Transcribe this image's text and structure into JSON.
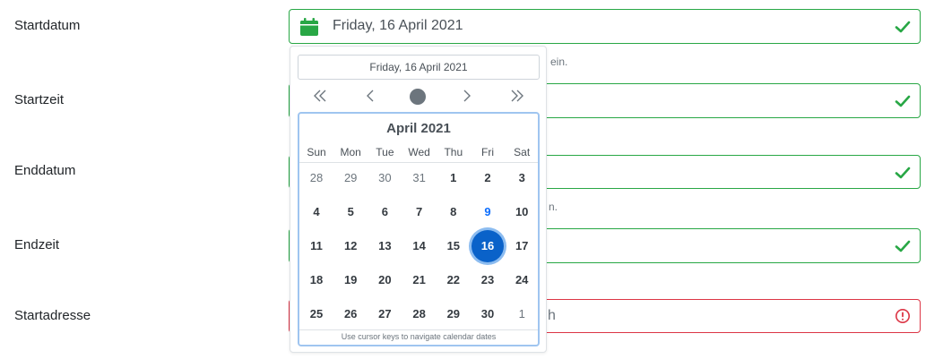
{
  "form": {
    "rows": [
      {
        "label": "Startdatum",
        "value": "Friday, 16 April 2021"
      },
      {
        "label": "Startzeit"
      },
      {
        "label": "Enddatum"
      },
      {
        "label": "Endzeit"
      },
      {
        "label": "Startadresse",
        "placeholder_tail": "h"
      }
    ],
    "help_fragments": {
      "row1": "ein.",
      "row3": "n."
    },
    "valid_color": "#28a745",
    "invalid_color": "#dc3545"
  },
  "datepicker": {
    "selected_text": "Friday, 16 April 2021",
    "nav": {
      "prev_year": "«",
      "prev_month": "‹",
      "next_month": "›",
      "next_year": "»"
    },
    "month_title": "April 2021",
    "weekdays": [
      "Sun",
      "Mon",
      "Tue",
      "Wed",
      "Thu",
      "Fri",
      "Sat"
    ],
    "weeks": [
      [
        "28",
        "29",
        "30",
        "31",
        "1",
        "2",
        "3"
      ],
      [
        "4",
        "5",
        "6",
        "7",
        "8",
        "9",
        "10"
      ],
      [
        "11",
        "12",
        "13",
        "14",
        "15",
        "16",
        "17"
      ],
      [
        "18",
        "19",
        "20",
        "21",
        "22",
        "23",
        "24"
      ],
      [
        "25",
        "26",
        "27",
        "28",
        "29",
        "30",
        "1"
      ]
    ],
    "footer": "Use cursor keys to navigate calendar dates",
    "selected_color": "#0a62c9",
    "today_color": "#0d6efd"
  }
}
